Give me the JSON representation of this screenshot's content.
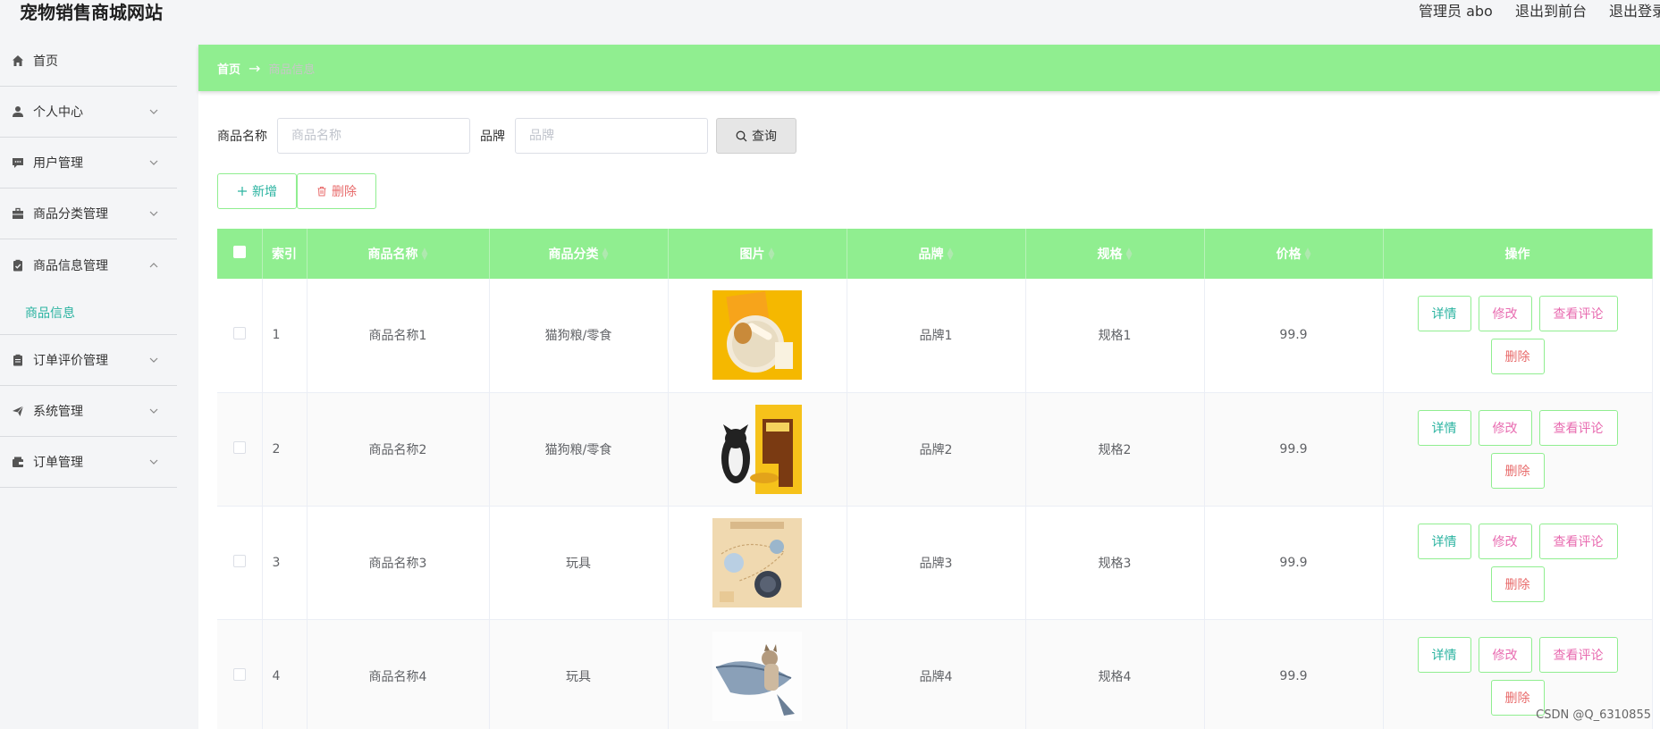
{
  "app": {
    "title": "宠物销售商城网站",
    "admin_label": "管理员 abo",
    "exit_front": "退出到前台",
    "logout": "退出登录"
  },
  "sidebar": {
    "items": [
      {
        "label": "首页",
        "icon": "home-icon"
      },
      {
        "label": "个人中心",
        "icon": "user-icon"
      },
      {
        "label": "用户管理",
        "icon": "chat-icon"
      },
      {
        "label": "商品分类管理",
        "icon": "briefcase-icon"
      },
      {
        "label": "商品信息管理",
        "icon": "clipboard-check-icon"
      },
      {
        "label": "订单评价管理",
        "icon": "clipboard-icon"
      },
      {
        "label": "系统管理",
        "icon": "send-icon"
      },
      {
        "label": "订单管理",
        "icon": "wallet-icon"
      }
    ],
    "submenu_active": "商品信息"
  },
  "breadcrumb": {
    "home": "首页",
    "arrow": "→",
    "current": "商品信息"
  },
  "search": {
    "name_label": "商品名称",
    "name_placeholder": "商品名称",
    "brand_label": "品牌",
    "brand_placeholder": "品牌",
    "query_label": "查询"
  },
  "actions": {
    "add_label": "新增",
    "delete_label": "删除"
  },
  "table": {
    "headers": {
      "index": "索引",
      "name": "商品名称",
      "category": "商品分类",
      "image": "图片",
      "brand": "品牌",
      "spec": "规格",
      "price": "价格",
      "ops": "操作"
    },
    "rows": [
      {
        "index": "1",
        "name": "商品名称1",
        "category": "猫狗粮/零食",
        "brand": "品牌1",
        "spec": "规格1",
        "price": "99.9"
      },
      {
        "index": "2",
        "name": "商品名称2",
        "category": "猫狗粮/零食",
        "brand": "品牌2",
        "spec": "规格2",
        "price": "99.9"
      },
      {
        "index": "3",
        "name": "商品名称3",
        "category": "玩具",
        "brand": "品牌3",
        "spec": "规格3",
        "price": "99.9"
      },
      {
        "index": "4",
        "name": "商品名称4",
        "category": "玩具",
        "brand": "品牌4",
        "spec": "规格4",
        "price": "99.9"
      }
    ],
    "op_labels": {
      "detail": "详情",
      "edit": "修改",
      "review": "查看评论",
      "delete": "删除"
    }
  },
  "watermark": "CSDN @Q_6310855",
  "colors": {
    "accent_green": "#90ee90",
    "teal_text": "#2ab3a0",
    "pink_text": "#e86bb0",
    "red_text": "#e86b6b"
  }
}
